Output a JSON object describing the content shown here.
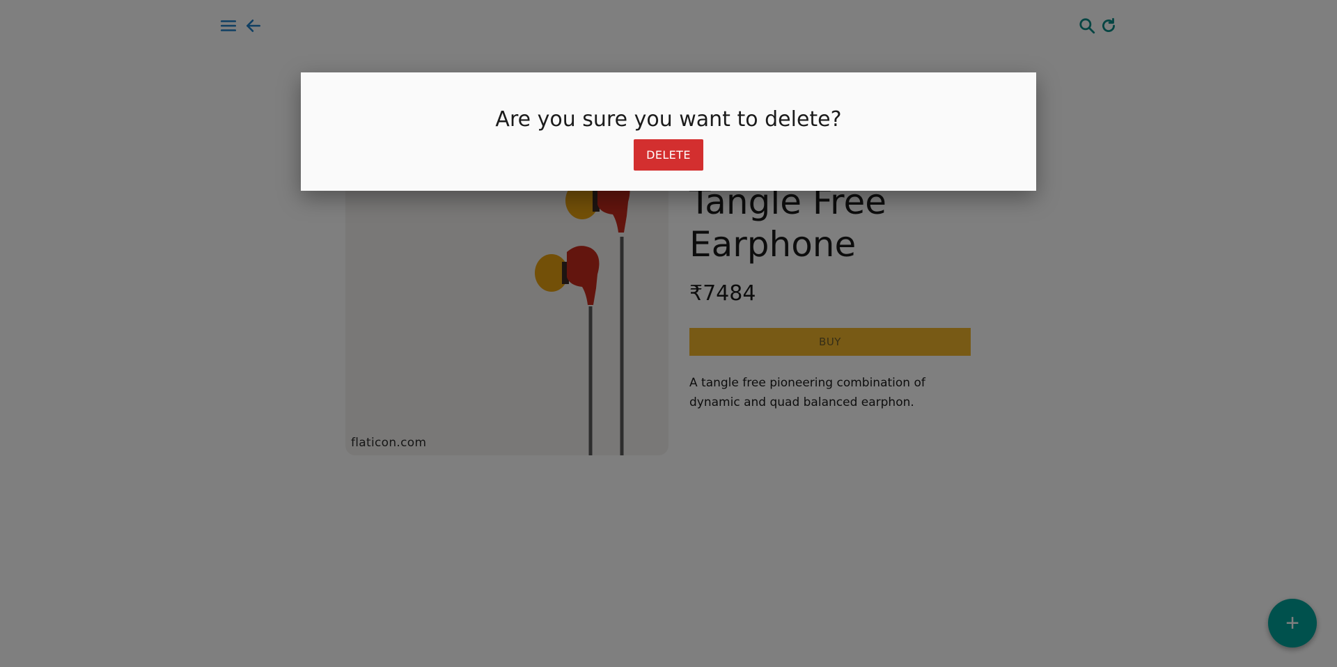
{
  "header": {
    "menu_icon": "menu-icon",
    "back_icon": "arrow-left-icon",
    "search_icon": "search-icon",
    "refresh_icon": "refresh-icon"
  },
  "product": {
    "title": "Tangle Free Earphone",
    "price": "₹7484",
    "buy_label": "BUY",
    "description": "A tangle free pioneering combination of dynamic and quad balanced earphon.",
    "image_watermark": "flaticon.com"
  },
  "fab": {
    "label": "+",
    "icon": "plus-icon"
  },
  "dialog": {
    "message": "Are you sure you want to delete?",
    "delete_label": "DELETE"
  },
  "colors": {
    "primary_blue": "#1f7fc6",
    "teal": "#0b8a86",
    "buy_yellow": "#f1b52a",
    "delete_red": "#d32f2f",
    "fab_teal": "#00a39a"
  }
}
